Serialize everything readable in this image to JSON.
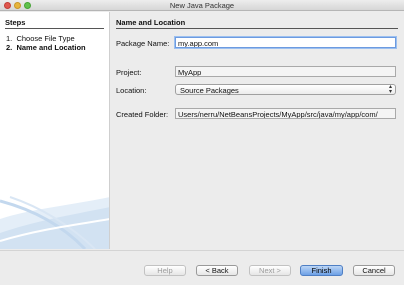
{
  "window": {
    "title": "New Java Package"
  },
  "steps": {
    "heading": "Steps",
    "items": [
      {
        "num": "1.",
        "label": "Choose File Type"
      },
      {
        "num": "2.",
        "label": "Name and Location"
      }
    ]
  },
  "panel": {
    "heading": "Name and Location",
    "package_name": {
      "label": "Package Name:",
      "value": "my.app.com"
    },
    "project": {
      "label": "Project:",
      "value": "MyApp"
    },
    "location": {
      "label": "Location:",
      "value": "Source Packages"
    },
    "created_folder": {
      "label": "Created Folder:",
      "value": "/Users/nerru/NetBeansProjects/MyApp/src/java/my/app/com"
    }
  },
  "buttons": {
    "help": "Help",
    "back": "< Back",
    "next": "Next >",
    "finish": "Finish",
    "cancel": "Cancel"
  },
  "colors": {
    "accent": "#6da0e6",
    "close": "#e0574f",
    "minimize": "#e7b53c",
    "maximize": "#60c14c"
  }
}
